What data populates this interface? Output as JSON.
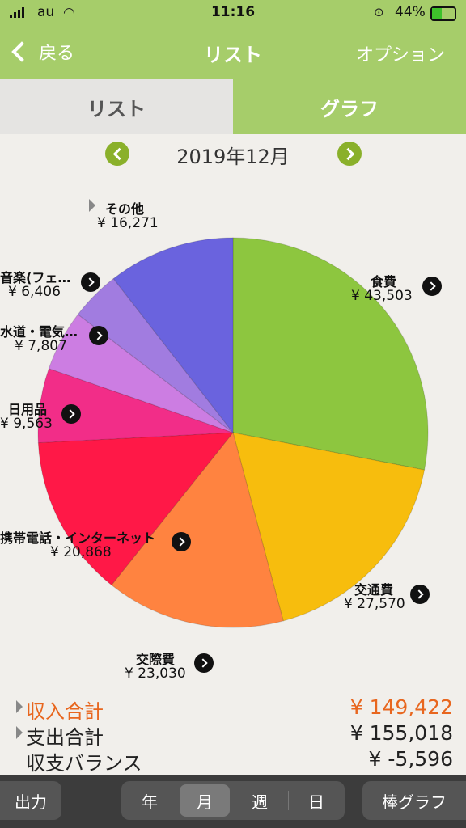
{
  "status": {
    "carrier": "au",
    "time": "11:16",
    "battery": "44%"
  },
  "nav": {
    "back_label": "戻る",
    "title": "リスト",
    "option_label": "オプション"
  },
  "tabs": [
    {
      "label": "リスト",
      "selected": false
    },
    {
      "label": "グラフ",
      "selected": true
    }
  ],
  "month": "2019年12月",
  "chart_data": {
    "type": "pie",
    "slices": [
      {
        "label": "食費",
        "amount": "¥ 43,503",
        "value": 43503,
        "color": "#8dc63f"
      },
      {
        "label": "交通費",
        "amount": "¥ 27,570",
        "value": 27570,
        "color": "#f7bd0d"
      },
      {
        "label": "交際費",
        "amount": "¥ 23,030",
        "value": 23030,
        "color": "#ff8340"
      },
      {
        "label": "携帯電話・インターネット",
        "amount": "¥ 20,868",
        "value": 20868,
        "color": "#ff1847"
      },
      {
        "label": "日用品",
        "amount": "¥ 9,563",
        "value": 9563,
        "color": "#f22d88"
      },
      {
        "label": "水道・電気…",
        "amount": "¥ 7,807",
        "value": 7807,
        "color": "#cc7de2"
      },
      {
        "label": "音楽(フェ…",
        "amount": "¥ 6,406",
        "value": 6406,
        "color": "#a17ce0"
      },
      {
        "label": "その他",
        "amount": "¥ 16,271",
        "value": 16271,
        "color": "#6a63de"
      }
    ]
  },
  "summary": {
    "income_label": "収入合計",
    "income_value": "¥ 149,422",
    "expense_label": "支出合計",
    "expense_value": "¥ 155,018",
    "balance_label": "収支バランス",
    "balance_value": "¥ -5,596",
    "income_color": "#e8661e"
  },
  "bottom": {
    "export_label": "出力",
    "periods": [
      {
        "label": "年"
      },
      {
        "label": "月",
        "selected": true
      },
      {
        "label": "週"
      },
      {
        "label": "日"
      }
    ],
    "bar_graph_label": "棒グラフ"
  }
}
